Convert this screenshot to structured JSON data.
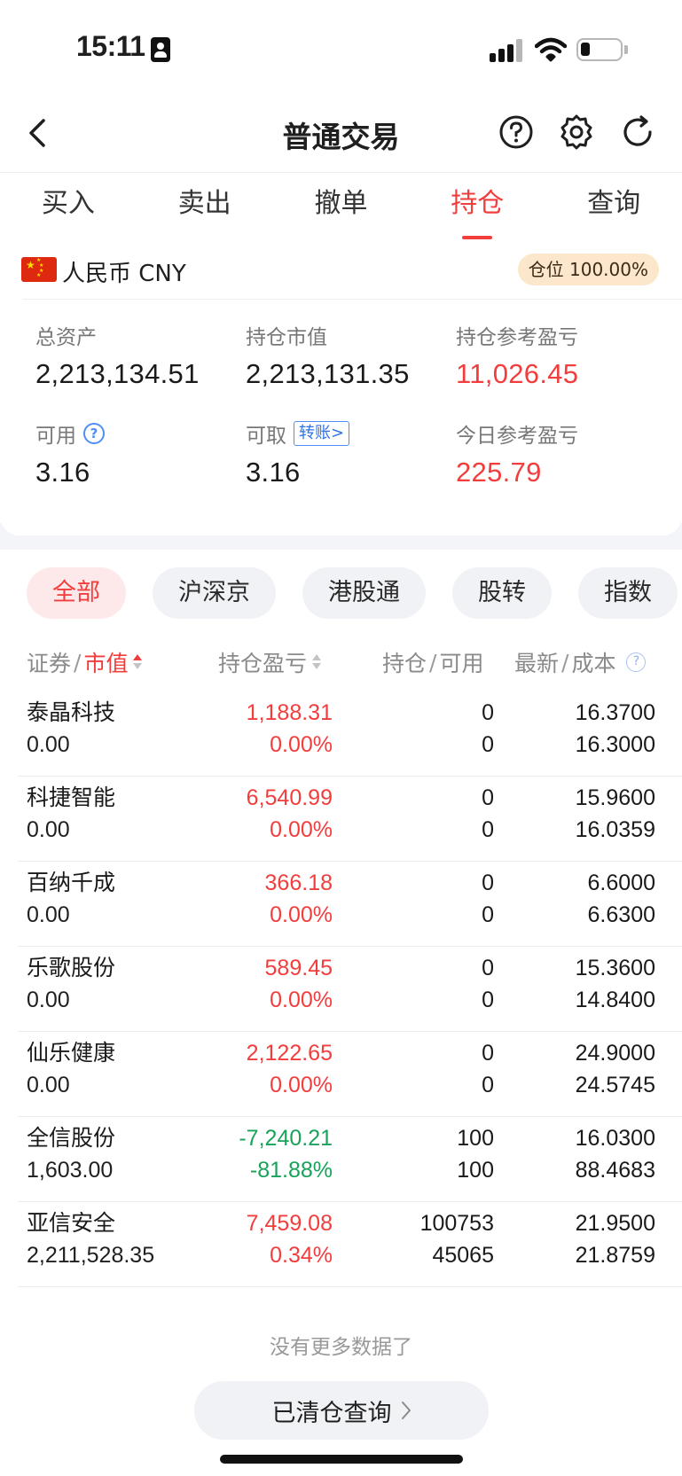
{
  "status_bar": {
    "time": "15:11"
  },
  "header": {
    "title": "普通交易"
  },
  "tabs": [
    {
      "label": "买入",
      "active": false
    },
    {
      "label": "卖出",
      "active": false
    },
    {
      "label": "撤单",
      "active": false
    },
    {
      "label": "持仓",
      "active": true
    },
    {
      "label": "查询",
      "active": false
    }
  ],
  "currency": {
    "label": "人民币 CNY",
    "position_badge": "仓位 100.00%"
  },
  "summary": {
    "total_assets_label": "总资产",
    "total_assets": "2,213,134.51",
    "market_value_label": "持仓市值",
    "market_value": "2,213,131.35",
    "position_pnl_label": "持仓参考盈亏",
    "position_pnl": "11,026.45",
    "available_label": "可用",
    "available": "3.16",
    "withdrawable_label": "可取",
    "transfer_label": "转账>",
    "withdrawable": "3.16",
    "today_pnl_label": "今日参考盈亏",
    "today_pnl": "225.79"
  },
  "filters": [
    "全部",
    "沪深京",
    "港股通",
    "股转",
    "指数"
  ],
  "active_filter": "全部",
  "table": {
    "headers": {
      "security": "证券",
      "market_value": "市值",
      "pnl": "持仓盈亏",
      "position": "持仓",
      "available": "可用",
      "latest": "最新",
      "cost": "成本",
      "sep": "/"
    },
    "rows": [
      {
        "name": "泰晶科技",
        "market_value": "0.00",
        "pnl": "1,188.31",
        "pnl_pct": "0.00%",
        "position": "0",
        "available": "0",
        "latest": "16.3700",
        "cost": "16.3000",
        "sign": "pos"
      },
      {
        "name": "科捷智能",
        "market_value": "0.00",
        "pnl": "6,540.99",
        "pnl_pct": "0.00%",
        "position": "0",
        "available": "0",
        "latest": "15.9600",
        "cost": "16.0359",
        "sign": "pos"
      },
      {
        "name": "百纳千成",
        "market_value": "0.00",
        "pnl": "366.18",
        "pnl_pct": "0.00%",
        "position": "0",
        "available": "0",
        "latest": "6.6000",
        "cost": "6.6300",
        "sign": "pos"
      },
      {
        "name": "乐歌股份",
        "market_value": "0.00",
        "pnl": "589.45",
        "pnl_pct": "0.00%",
        "position": "0",
        "available": "0",
        "latest": "15.3600",
        "cost": "14.8400",
        "sign": "pos"
      },
      {
        "name": "仙乐健康",
        "market_value": "0.00",
        "pnl": "2,122.65",
        "pnl_pct": "0.00%",
        "position": "0",
        "available": "0",
        "latest": "24.9000",
        "cost": "24.5745",
        "sign": "pos"
      },
      {
        "name": "全信股份",
        "market_value": "1,603.00",
        "pnl": "-7,240.21",
        "pnl_pct": "-81.88%",
        "position": "100",
        "available": "100",
        "latest": "16.0300",
        "cost": "88.4683",
        "sign": "neg"
      },
      {
        "name": "亚信安全",
        "market_value": "2,211,528.35",
        "pnl": "7,459.08",
        "pnl_pct": "0.34%",
        "position": "100753",
        "available": "45065",
        "latest": "21.9500",
        "cost": "21.8759",
        "sign": "pos"
      }
    ]
  },
  "footer": {
    "no_more": "没有更多数据了",
    "closed_query": "已清仓查询"
  },
  "colors": {
    "accent_red": "#f23d3d",
    "loss_green": "#17a45a",
    "link_blue": "#2f73e8",
    "badge_bg": "#fde7cc"
  },
  "icons": [
    "back-icon",
    "help-icon",
    "settings-icon",
    "refresh-icon",
    "china-flag-icon",
    "question-icon",
    "sort-icon",
    "info-icon",
    "chevron-right-icon"
  ]
}
